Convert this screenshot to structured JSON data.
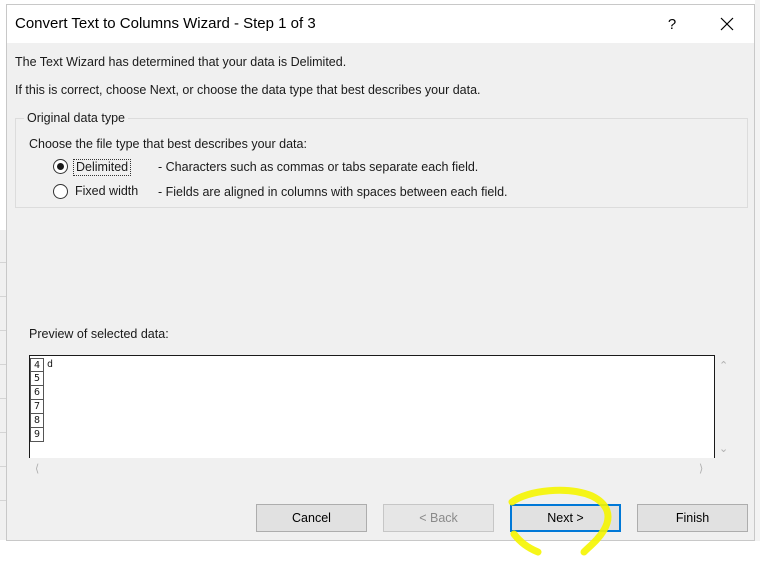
{
  "dialog": {
    "title": "Convert Text to Columns Wizard - Step 1 of 3",
    "help_label": "?",
    "messages": {
      "line1": "The Text Wizard has determined that your data is Delimited.",
      "line2": "If this is correct, choose Next, or choose the data type that best describes your data."
    },
    "original_data_type": {
      "legend": "Original data type",
      "prompt": "Choose the file type that best describes your data:",
      "options": [
        {
          "label": "Delimited",
          "description": "- Characters such as commas or tabs separate each field.",
          "selected": true
        },
        {
          "label": "Fixed width",
          "description": "- Fields are aligned in columns with spaces between each field.",
          "selected": false
        }
      ]
    },
    "preview": {
      "label": "Preview of selected data:",
      "row_numbers": [
        "4",
        "5",
        "6",
        "7",
        "8",
        "9"
      ],
      "first_row_text": "d"
    },
    "buttons": {
      "cancel": "Cancel",
      "back": "< Back",
      "next": "Next >",
      "finish": "Finish"
    }
  },
  "colors": {
    "dialog_bg": "#f0f0f0",
    "focus_border": "#0078d7",
    "highlight_marker": "#f5f500"
  },
  "icons": {
    "close": "close-icon",
    "scroll_up": "chevron-up-icon",
    "scroll_down": "chevron-down-icon",
    "scroll_left": "chevron-left-icon",
    "scroll_right": "chevron-right-icon"
  }
}
